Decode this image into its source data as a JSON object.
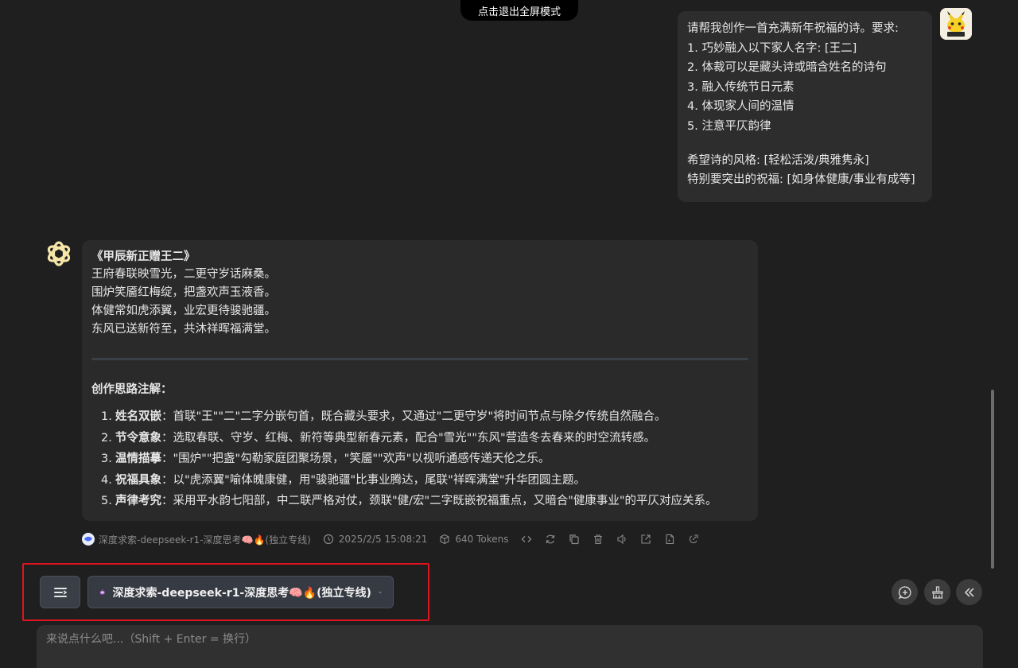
{
  "fullscreen_exit_label": "点击退出全屏模式",
  "user_message": {
    "lines": [
      "请帮我创作一首充满新年祝福的诗。要求:",
      "1. 巧妙融入以下家人名字: [王二]",
      "2. 体裁可以是藏头诗或暗含姓名的诗句",
      "3. 融入传统节日元素",
      "4. 体现家人间的温情",
      "5. 注意平仄韵律"
    ],
    "extra_lines": [
      "希望诗的风格: [轻松活泼/典雅隽永]",
      "特别要突出的祝福: [如身体健康/事业有成等]"
    ]
  },
  "assistant_message": {
    "poem_title": "《甲辰新正赠王二》",
    "poem_lines": [
      "王府春联映雪光，二更守岁话麻桑。",
      "围炉笑靥红梅绽，把盏欢声玉液香。",
      "体健常如虎添翼，业宏更待骏驰疆。",
      "东风已送新符至，共沐祥晖福满堂。"
    ],
    "notes_title": "创作思路注解：",
    "notes": [
      {
        "num": "1.",
        "key": "姓名双嵌",
        "text": "：首联\"王\"\"二\"二字分嵌句首，既合藏头要求，又通过\"二更守岁\"将时间节点与除夕传统自然融合。"
      },
      {
        "num": "2.",
        "key": "节令意象",
        "text": "：选取春联、守岁、红梅、新符等典型新春元素，配合\"雪光\"\"东风\"营造冬去春来的时空流转感。"
      },
      {
        "num": "3.",
        "key": "温情描摹",
        "text": "：\"围炉\"\"把盏\"勾勒家庭团聚场景，\"笑靥\"\"欢声\"以视听通感传递天伦之乐。"
      },
      {
        "num": "4.",
        "key": "祝福具象",
        "text": "：以\"虎添翼\"喻体魄康健，用\"骏驰疆\"比事业腾达，尾联\"祥晖满堂\"升华团圆主题。"
      },
      {
        "num": "5.",
        "key": "声律考究",
        "text": "：采用平水韵七阳部，中二联严格对仗，颈联\"健/宏\"二字既嵌祝福重点，又暗合\"健康事业\"的平仄对应关系。"
      }
    ]
  },
  "meta": {
    "model": "深度求索-deepseek-r1-深度思考🧠🔥(独立专线)",
    "timestamp": "2025/2/5 15:08:21",
    "tokens": "640 Tokens"
  },
  "toolbar": {
    "model_select_label": "深度求索-deepseek-r1-深度思考🧠🔥(独立专线)"
  },
  "composer": {
    "placeholder": "来说点什么吧...（Shift + Enter = 换行）"
  }
}
